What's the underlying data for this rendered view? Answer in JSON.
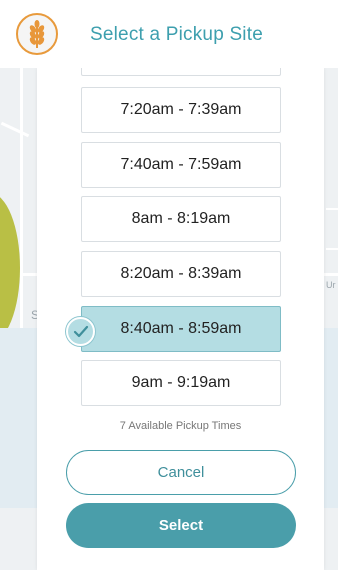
{
  "header": {
    "title": "Select a Pickup Site",
    "logo_icon": "wheat-icon",
    "accent_color": "#3d9fae"
  },
  "times": {
    "slots": [
      {
        "label": ""
      },
      {
        "label": "7:20am  -  7:39am"
      },
      {
        "label": "7:40am  -  7:59am"
      },
      {
        "label": "8am  -  8:19am"
      },
      {
        "label": "8:20am  -  8:39am"
      },
      {
        "label": "8:40am  -  8:59am",
        "selected": true
      },
      {
        "label": "9am  -  9:19am"
      }
    ],
    "available_text": "7 Available Pickup Times",
    "selected_indicator_icon": "check-icon"
  },
  "actions": {
    "cancel_label": "Cancel",
    "select_label": "Select"
  },
  "map": {
    "label_s": "S",
    "label_u": "Ur"
  }
}
